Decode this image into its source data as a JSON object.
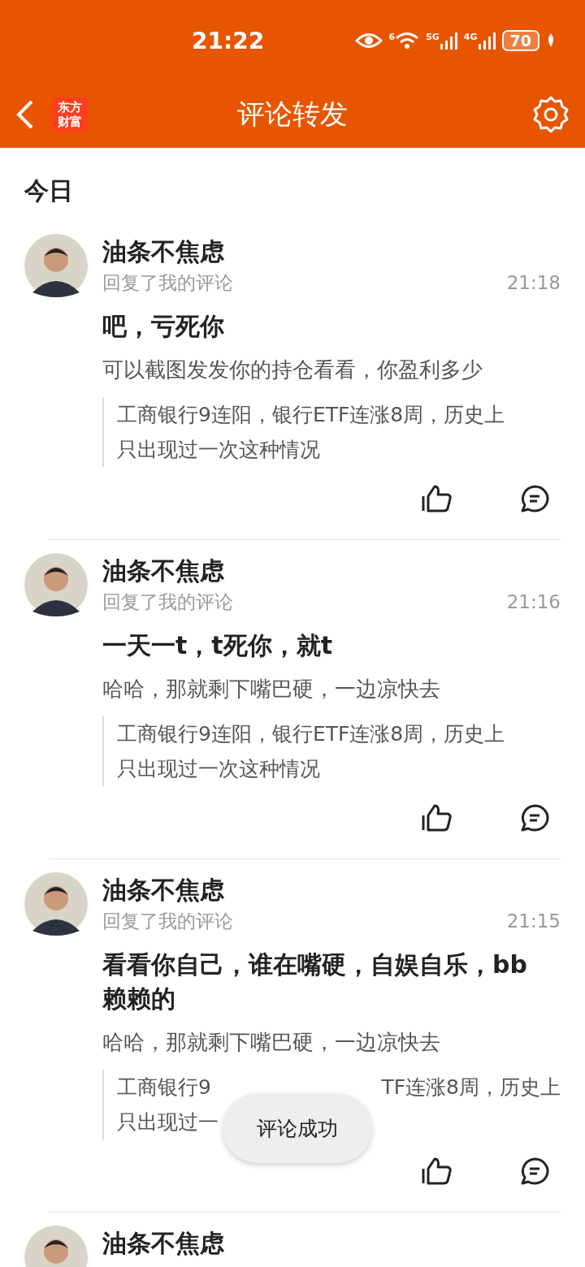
{
  "status_bar": {
    "time": "21:22",
    "network_a": "5G",
    "network_b": "4G",
    "wifi_label": "6",
    "battery": "70"
  },
  "header": {
    "logo_line_1": "东方",
    "logo_line_2": "财富",
    "title": "评论转发"
  },
  "section": "今日",
  "items": [
    {
      "name": "油条不焦虑",
      "action": "回复了我的评论",
      "time": "21:18",
      "title": "吧，亏死你",
      "reply": "可以截图发发你的持仓看看，你盈利多少",
      "quote_lines": [
        [
          "工商银行9连阳，银行ETF连涨8周，历史上"
        ],
        [
          "只出现过一次这种情况"
        ]
      ]
    },
    {
      "name": "油条不焦虑",
      "action": "回复了我的评论",
      "time": "21:16",
      "title": "一天一t，t死你，就t",
      "reply": "哈哈，那就剩下嘴巴硬，一边凉快去",
      "quote_lines": [
        [
          "工商银行9连阳，银行ETF连涨8周，历史上"
        ],
        [
          "只出现过一次这种情况"
        ]
      ]
    },
    {
      "name": "油条不焦虑",
      "action": "回复了我的评论",
      "time": "21:15",
      "title": "看看你自己，谁在嘴硬，自娱自乐，bb赖赖的",
      "reply": "哈哈，那就剩下嘴巴硬，一边凉快去",
      "quote_lines": [
        [
          "工商银行9",
          "TF连涨8周，历史上"
        ],
        [
          "只出现过一"
        ]
      ]
    },
    {
      "name": "油条不焦虑"
    }
  ],
  "toast": "评论成功"
}
